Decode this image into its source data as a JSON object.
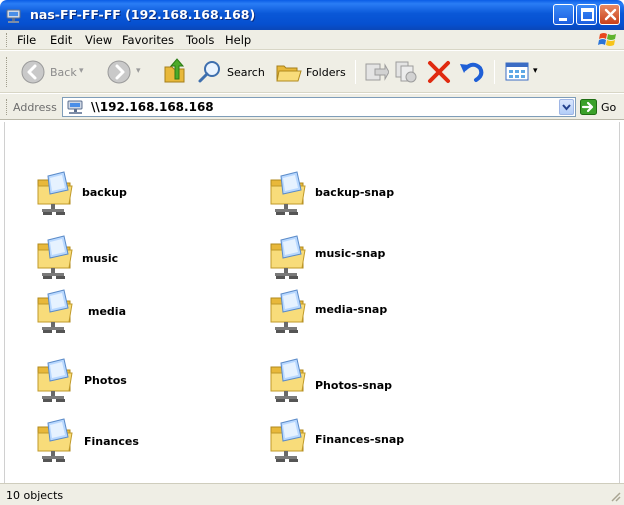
{
  "window": {
    "title": "nas-FF-FF-FF (192.168.168.168)",
    "app_icon": "network-drive-icon",
    "controls": {
      "minimize": "minimize-icon",
      "maximize": "maximize-icon",
      "close": "close-icon"
    }
  },
  "menu": {
    "items": [
      "File",
      "Edit",
      "View",
      "Favorites",
      "Tools",
      "Help"
    ],
    "logo": "windows-logo-icon"
  },
  "toolbar": {
    "back_label": "Back",
    "search_label": "Search",
    "folders_label": "Folders",
    "icons": [
      "back-icon",
      "forward-icon",
      "up-folder-icon",
      "search-icon",
      "folders-icon",
      "move-to-icon",
      "copy-to-icon",
      "delete-icon",
      "undo-icon",
      "views-icon"
    ]
  },
  "address": {
    "label": "Address",
    "value": "\\\\192.168.168.168",
    "go_label": "Go"
  },
  "folders": [
    {
      "name": "backup"
    },
    {
      "name": "backup-snap"
    },
    {
      "name": "music"
    },
    {
      "name": "music-snap"
    },
    {
      "name": "media"
    },
    {
      "name": "media-snap"
    },
    {
      "name": "Photos"
    },
    {
      "name": "Photos-snap"
    },
    {
      "name": "Finances"
    },
    {
      "name": "Finances-snap"
    }
  ],
  "status": {
    "text": "10 objects"
  },
  "colors": {
    "title_bar": "#0a58d8",
    "chrome": "#efeee5",
    "close_button": "#c8401a",
    "folder": "#f5d46a"
  }
}
